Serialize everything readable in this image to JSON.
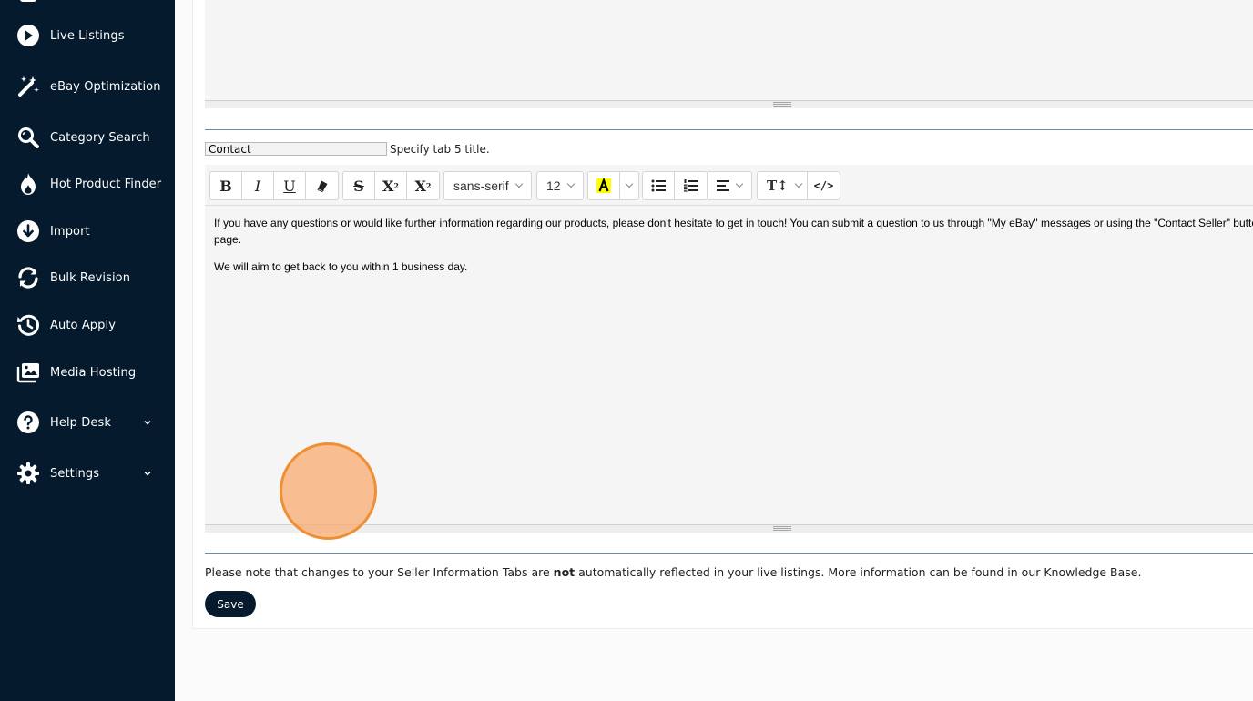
{
  "sidebar": {
    "items": [
      {
        "label": "Live Listings",
        "icon": "play-circle-icon"
      },
      {
        "label": "eBay Optimization",
        "icon": "magic-wand-icon"
      },
      {
        "label": "Category Search",
        "icon": "search-icon"
      },
      {
        "label": "Hot Product Finder",
        "icon": "flame-icon"
      },
      {
        "label": "Import",
        "icon": "download-circle-icon"
      },
      {
        "label": "Bulk Revision",
        "icon": "sync-icon"
      },
      {
        "label": "Auto Apply",
        "icon": "history-icon"
      },
      {
        "label": "Media Hosting",
        "icon": "images-icon"
      },
      {
        "label": "Help Desk",
        "icon": "help-circle-icon",
        "expandable": true
      },
      {
        "label": "Settings",
        "icon": "gear-icon",
        "expandable": true
      }
    ]
  },
  "tab": {
    "title_value": "Contact",
    "hint": "Specify tab 5 title."
  },
  "toolbar": {
    "font_family": "sans-serif",
    "font_size": "12",
    "highlight_color": "#ffff00"
  },
  "editor": {
    "paragraph1_line1": "If you have any questions or would like further information regarding our products, please don't hesitate to get in touch! You can submit a question to us through \"My eBay\" messages or using the \"Contact Seller\" butto",
    "paragraph1_line2": "page.",
    "paragraph2": "We will aim to get back to you within 1 business day."
  },
  "note": {
    "before": "Please note that changes to your Seller Information Tabs are ",
    "bold": "not",
    "after": " automatically reflected in your live listings. More information can be found in our Knowledge Base."
  },
  "save_label": "Save",
  "colors": {
    "sidebar_bg": "#051a2c",
    "save_bg": "#051a2c",
    "cursor_highlight": "#f08e33"
  }
}
